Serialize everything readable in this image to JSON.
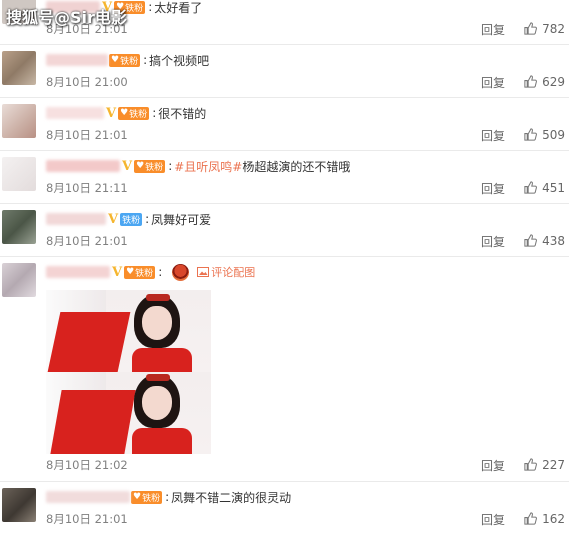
{
  "watermark": "搜狐号@Sir电影",
  "reply_label": "回复",
  "comments": [
    {
      "text": "太好看了",
      "time": "8月10日 21:01",
      "likes": "782",
      "badge": "铁粉"
    },
    {
      "text": "搞个视频吧",
      "time": "8月10日 21:00",
      "likes": "629",
      "badge": "铁粉"
    },
    {
      "text": "很不错的",
      "time": "8月10日 21:01",
      "likes": "509",
      "badge": "铁粉"
    },
    {
      "tag": "#且听凤鸣#",
      "text": "杨超越演的还不错哦",
      "time": "8月10日 21:11",
      "likes": "451",
      "badge": "铁粉"
    },
    {
      "text": "凤舞好可爱",
      "time": "8月10日 21:01",
      "likes": "438",
      "badge": "铁粉"
    },
    {
      "photo_link": "评论配图",
      "time": "8月10日 21:02",
      "likes": "227",
      "badge": "铁粉"
    },
    {
      "text": "凤舞不错二演的很灵动",
      "time": "8月10日 21:01",
      "likes": "162",
      "badge": "铁粉"
    }
  ],
  "colors": {
    "badge_orange": "#f98d2a",
    "badge_blue": "#4ba6f2",
    "topic": "#eb7350",
    "vip": "#f5b52e"
  },
  "icons": [
    "thumbs-up-icon",
    "photo-icon",
    "vip-v-icon",
    "heart-icon"
  ]
}
